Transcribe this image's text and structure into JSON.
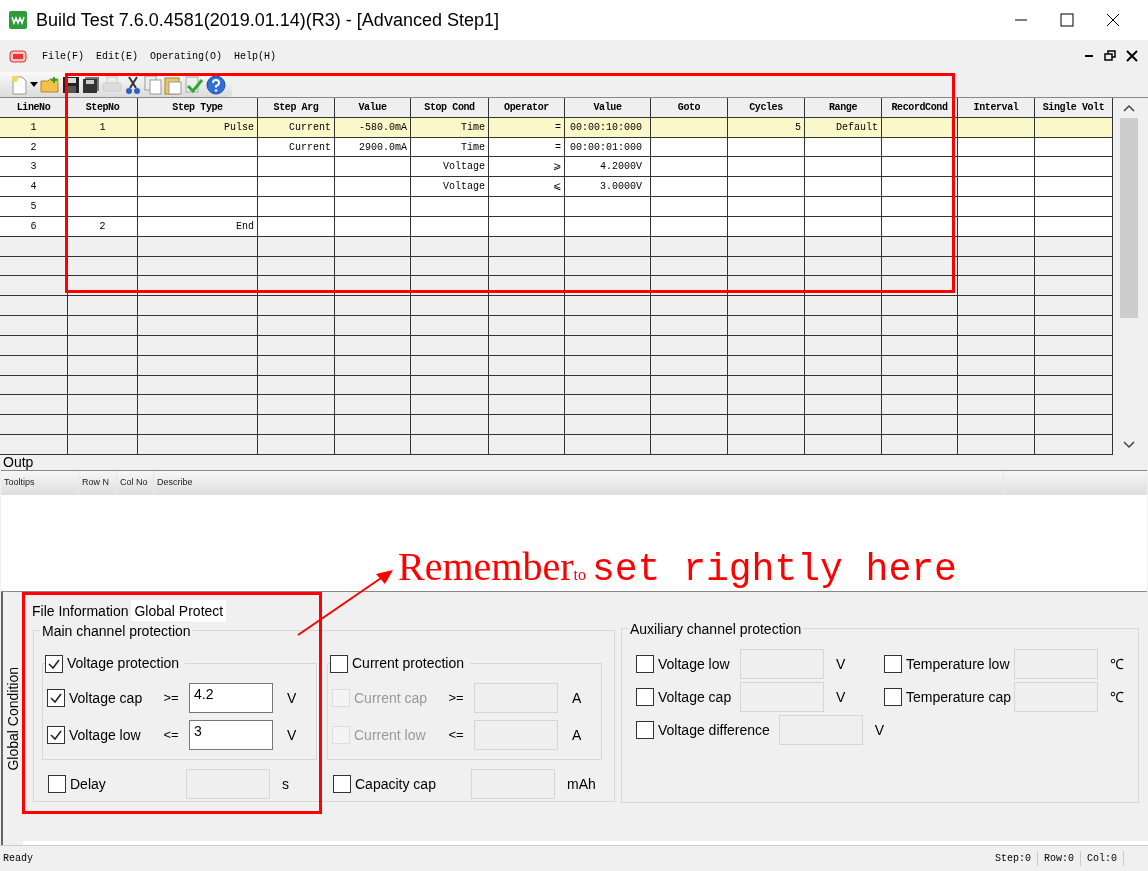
{
  "window": {
    "title": "Build Test  7.6.0.4581(2019.01.14)(R3) - [Advanced Step1]"
  },
  "menu": [
    "File(F)",
    "Edit(E)",
    "Operating(O)",
    "Help(H)"
  ],
  "grid": {
    "columns": [
      "LineNo",
      "StepNo",
      "Step Type",
      "Step Arg",
      "Value",
      "Stop Cond",
      "Operator",
      "Value",
      "Goto",
      "Cycles",
      "Range",
      "RecordCond",
      "Interval",
      "Single Volt"
    ],
    "rows": [
      {
        "selected": true,
        "cells": [
          "1",
          "1",
          "Pulse",
          "Current",
          "-580.0mA",
          "Time",
          "=",
          "00:00:10:000",
          "",
          "5",
          "Default",
          "",
          "",
          ""
        ]
      },
      {
        "selected": false,
        "cells": [
          "2",
          "",
          "",
          "Current",
          "2900.0mA",
          "Time",
          "=",
          "00:00:01:000",
          "",
          "",
          "",
          "",
          "",
          ""
        ]
      },
      {
        "selected": false,
        "cells": [
          "3",
          "",
          "",
          "",
          "",
          "Voltage",
          "⩾",
          "4.2000V",
          "",
          "",
          "",
          "",
          "",
          ""
        ]
      },
      {
        "selected": false,
        "cells": [
          "4",
          "",
          "",
          "",
          "",
          "Voltage",
          "⩽",
          "3.0000V",
          "",
          "",
          "",
          "",
          "",
          ""
        ]
      },
      {
        "selected": false,
        "cells": [
          "5",
          "",
          "",
          "",
          "",
          "",
          "",
          "",
          "",
          "",
          "",
          "",
          "",
          ""
        ]
      },
      {
        "selected": false,
        "cells": [
          "6",
          "2",
          "End",
          "",
          "",
          "",
          "",
          "",
          "",
          "",
          "",
          "",
          "",
          ""
        ]
      }
    ]
  },
  "output": {
    "title": "Outp",
    "columns": [
      "Tooltips",
      "Row N",
      "Col No",
      "Describe"
    ]
  },
  "global_condition": {
    "side_label": "Global Condition",
    "tabs": [
      {
        "label": "File Information",
        "selected": false
      },
      {
        "label": "Global Protect",
        "selected": true
      }
    ],
    "main": {
      "title": "Main channel protection",
      "groups": [
        {
          "label": "Voltage protection",
          "checked": true,
          "rows": [
            {
              "label": "Voltage cap",
              "checked": true,
              "disabled": false,
              "operator": ">=",
              "value": "4.2",
              "unit": "V"
            },
            {
              "label": "Voltage low",
              "checked": true,
              "disabled": false,
              "operator": "<=",
              "value": "3",
              "unit": "V"
            }
          ],
          "extra": {
            "label": "Delay",
            "checked": false,
            "unit": "s"
          }
        },
        {
          "label": "Current protection",
          "checked": false,
          "rows": [
            {
              "label": "Current cap",
              "checked": false,
              "disabled": true,
              "operator": ">=",
              "value": "",
              "unit": "A"
            },
            {
              "label": "Current low",
              "checked": false,
              "disabled": true,
              "operator": "<=",
              "value": "",
              "unit": "A"
            }
          ],
          "extra": {
            "label": "Capacity cap",
            "checked": false,
            "unit": "mAh"
          }
        }
      ]
    },
    "aux": {
      "title": "Auxiliary channel protection",
      "items": [
        {
          "label": "Voltage low",
          "checked": false,
          "unit": "V"
        },
        {
          "label": "Temperature low",
          "checked": false,
          "unit": "℃"
        },
        {
          "label": "Voltage cap",
          "checked": false,
          "unit": "V"
        },
        {
          "label": "Temperature cap",
          "checked": false,
          "unit": "℃"
        },
        {
          "label": "Voltage difference",
          "checked": false,
          "unit": "V"
        }
      ]
    }
  },
  "status_bar": [
    "Ready",
    "Step:0",
    "Row:0",
    "Col:0"
  ],
  "annotation": {
    "big": "Remember",
    "small": "to",
    "rest": "set rightly here"
  }
}
